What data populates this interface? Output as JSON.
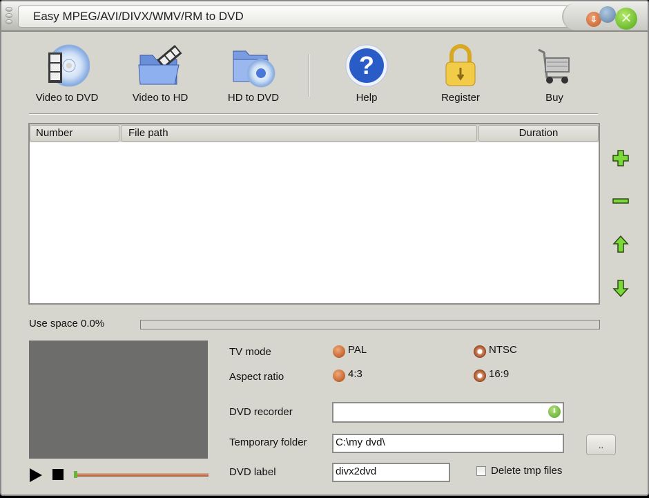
{
  "window": {
    "title": "Easy MPEG/AVI/DIVX/WMV/RM to DVD",
    "controls": {
      "minimize_glyph": "⇩",
      "close_glyph": "✕"
    }
  },
  "toolbar": {
    "items": [
      {
        "id": "video-to-dvd",
        "label": "Video to DVD",
        "icon": "film-disc-icon"
      },
      {
        "id": "video-to-hd",
        "label": "Video to HD",
        "icon": "folder-film-icon"
      },
      {
        "id": "hd-to-dvd",
        "label": "HD to DVD",
        "icon": "folder-disc-icon"
      },
      {
        "id": "help",
        "label": "Help",
        "icon": "help-icon"
      },
      {
        "id": "register",
        "label": "Register",
        "icon": "padlock-icon"
      },
      {
        "id": "buy",
        "label": "Buy",
        "icon": "shopping-cart-icon"
      }
    ]
  },
  "file_list": {
    "columns": [
      "Number",
      "File path",
      "Duration"
    ],
    "rows": []
  },
  "side_buttons": [
    "add-icon",
    "remove-icon",
    "move-up-icon",
    "move-down-icon"
  ],
  "usage": {
    "label": "Use space 0.0%",
    "percent": 0.0
  },
  "colors": {
    "accent_green": "#6cc830",
    "radio_orange": "#c2642e",
    "preview_bg": "#6d6d6b"
  },
  "settings": {
    "tv_mode": {
      "label": "TV mode",
      "options": [
        "PAL",
        "NTSC"
      ],
      "selected": "NTSC"
    },
    "aspect_ratio": {
      "label": "Aspect ratio",
      "options": [
        "4:3",
        "16:9"
      ],
      "selected": "16:9"
    },
    "dvd_recorder": {
      "label": "DVD recorder",
      "value": ""
    },
    "temp_folder": {
      "label": "Temporary folder",
      "value": "C:\\my dvd\\",
      "browse_label": ".."
    },
    "dvd_label": {
      "label": "DVD label",
      "value": "divx2dvd"
    },
    "delete_tmp": {
      "label": "Delete tmp files",
      "checked": false
    }
  },
  "player": {
    "position": 0.0
  }
}
